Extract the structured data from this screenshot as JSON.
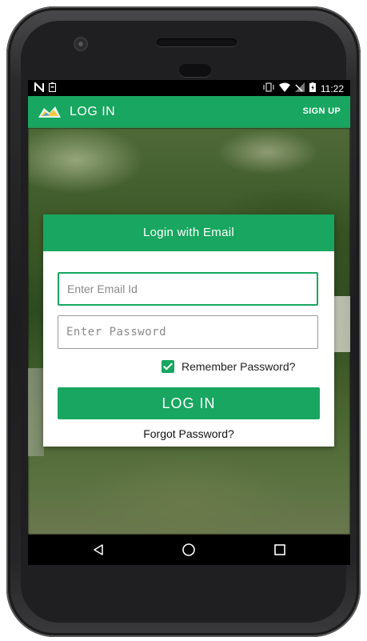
{
  "status_bar": {
    "time": "11:22",
    "left_icons": [
      "notification-n-icon",
      "battery-saver-icon"
    ],
    "right_icons": [
      "vibrate-icon",
      "wifi-icon",
      "signal-icon",
      "battery-icon"
    ]
  },
  "app_bar": {
    "title": "LOG IN",
    "signup_label": "SIGN UP",
    "logo": "map-logo-icon"
  },
  "login_card": {
    "header": "Login with Email",
    "email_placeholder": "Enter Email Id",
    "password_placeholder": "Enter Password",
    "remember_label": "Remember Password?",
    "remember_checked": true,
    "login_button": "LOG IN",
    "forgot_label": "Forgot Password?"
  },
  "nav_bar": {
    "buttons": [
      "back-icon",
      "home-icon",
      "recents-icon"
    ]
  },
  "colors": {
    "primary": "#18a660",
    "status_bar": "#000000",
    "card_bg": "#ffffff"
  }
}
